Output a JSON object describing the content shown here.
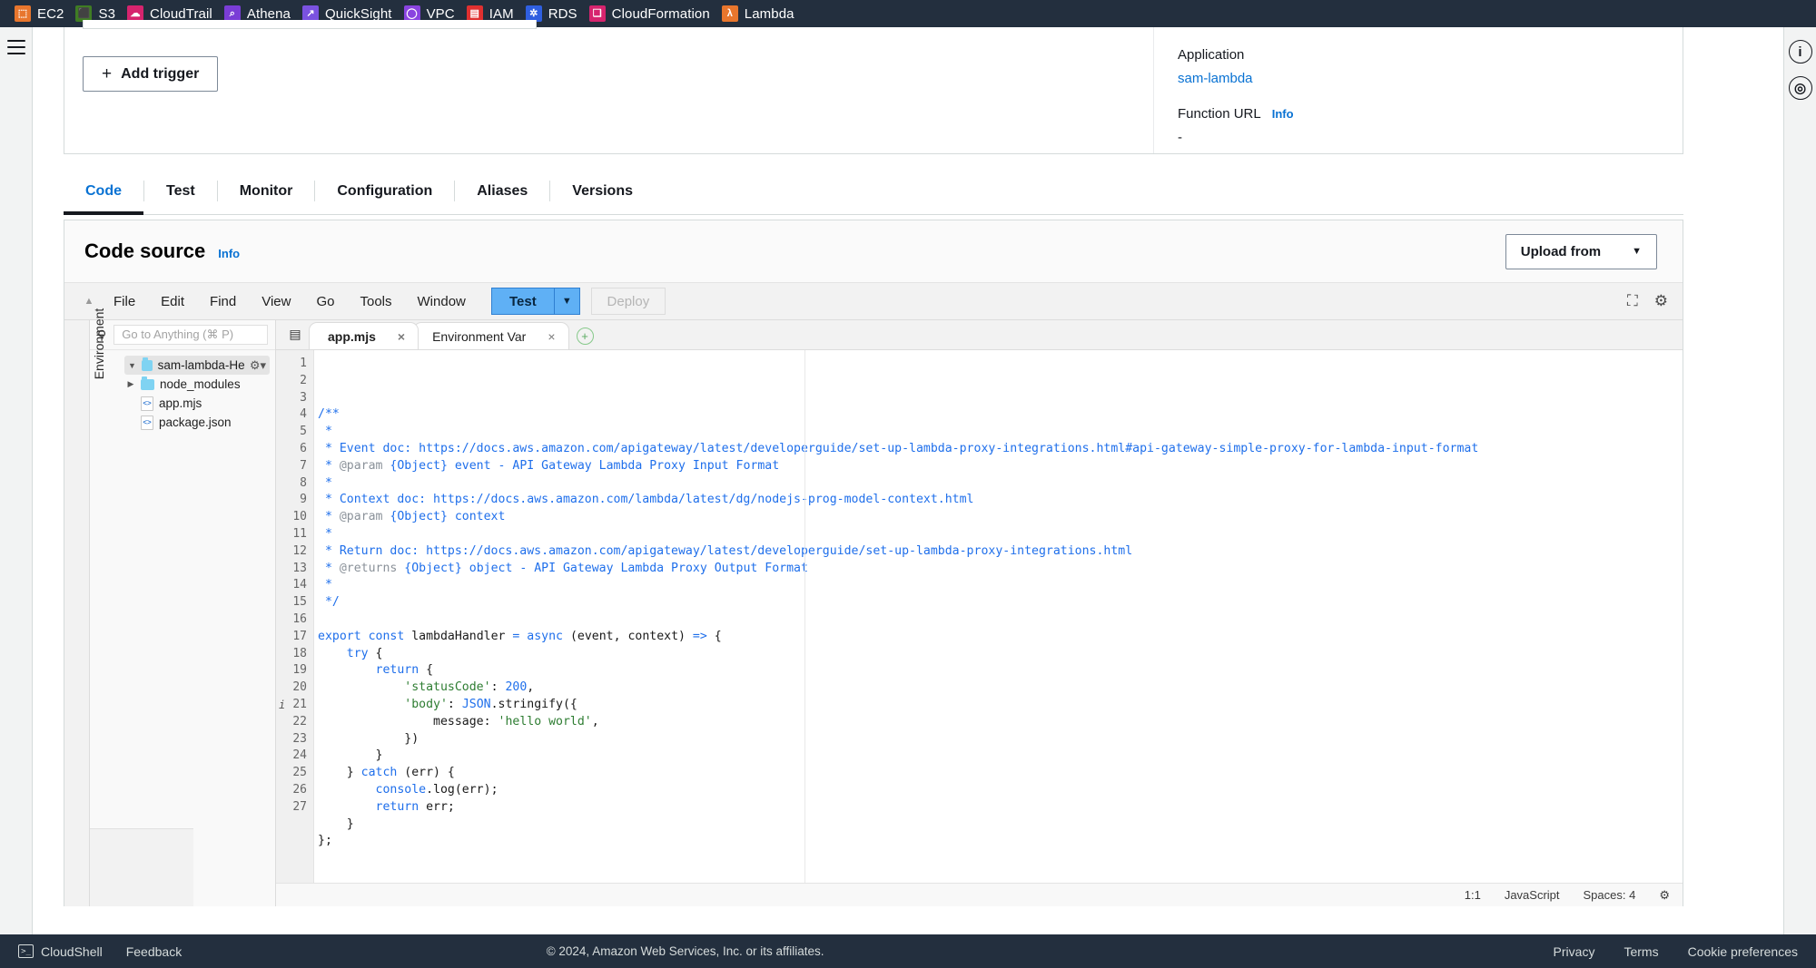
{
  "top_services": [
    {
      "label": "EC2",
      "icon": "ec2-icon",
      "color": "#e8762d",
      "glyph": "⬚"
    },
    {
      "label": "S3",
      "icon": "s3-icon",
      "color": "#3f7d23",
      "glyph": "⬛"
    },
    {
      "label": "CloudTrail",
      "icon": "cloudtrail-icon",
      "color": "#d6246e",
      "glyph": "☁"
    },
    {
      "label": "Athena",
      "icon": "athena-icon",
      "color": "#7a3dd6",
      "glyph": "⌕"
    },
    {
      "label": "QuickSight",
      "icon": "quicksight-icon",
      "color": "#7a52e0",
      "glyph": "↗"
    },
    {
      "label": "VPC",
      "icon": "vpc-icon",
      "color": "#8a44e0",
      "glyph": "◯"
    },
    {
      "label": "IAM",
      "icon": "iam-icon",
      "color": "#e03030",
      "glyph": "▤"
    },
    {
      "label": "RDS",
      "icon": "rds-icon",
      "color": "#2f5fe0",
      "glyph": "✲"
    },
    {
      "label": "CloudFormation",
      "icon": "cloudformation-icon",
      "color": "#d6246e",
      "glyph": "❑"
    },
    {
      "label": "Lambda",
      "icon": "lambda-icon",
      "color": "#e8762d",
      "glyph": "λ"
    }
  ],
  "overview": {
    "add_trigger_label": "Add trigger",
    "application_label": "Application",
    "application_value": "sam-lambda",
    "function_url_label": "Function URL",
    "function_url_info": "Info",
    "function_url_value": "-"
  },
  "tabs": [
    {
      "label": "Code",
      "active": true
    },
    {
      "label": "Test",
      "active": false
    },
    {
      "label": "Monitor",
      "active": false
    },
    {
      "label": "Configuration",
      "active": false
    },
    {
      "label": "Aliases",
      "active": false
    },
    {
      "label": "Versions",
      "active": false
    }
  ],
  "code_source": {
    "title": "Code source",
    "info": "Info",
    "upload_from": "Upload from",
    "caret": "▼"
  },
  "ide": {
    "menus": [
      "File",
      "Edit",
      "Find",
      "View",
      "Go",
      "Tools",
      "Window"
    ],
    "test_button": "Test",
    "test_caret": "▼",
    "deploy_button": "Deploy",
    "expand_icon": "⛶",
    "settings_icon": "⚙",
    "collapse_icon": "▲",
    "environment_label": "Environment",
    "search_placeholder": "Go to Anything (⌘ P)",
    "search_icon": "⚲",
    "file_tree": [
      {
        "label": "sam-lambda-HelloW",
        "type": "folder",
        "expanded": true,
        "depth": 0,
        "selected": true,
        "twisty": "▼",
        "gear": "⚙▾"
      },
      {
        "label": "node_modules",
        "type": "folder",
        "expanded": false,
        "depth": 1,
        "selected": false,
        "twisty": "▶",
        "gear": ""
      },
      {
        "label": "app.mjs",
        "type": "file",
        "expanded": false,
        "depth": 1,
        "selected": false,
        "twisty": "",
        "gear": ""
      },
      {
        "label": "package.json",
        "type": "file",
        "expanded": false,
        "depth": 1,
        "selected": false,
        "twisty": "",
        "gear": ""
      }
    ],
    "editor_tabs": [
      {
        "label": "app.mjs",
        "active": true,
        "close": "×"
      },
      {
        "label": "Environment Var",
        "active": false,
        "close": "×"
      }
    ],
    "add_tab_icon": "+",
    "tab_list_icon": "▤",
    "status": {
      "position": "1:1",
      "language": "JavaScript",
      "spaces": "Spaces: 4",
      "gear": "⚙"
    },
    "warning_line": 21,
    "warning_glyph": "i",
    "total_lines": 27
  },
  "code_lines": [
    {
      "n": 1,
      "segments": [
        {
          "t": "/**",
          "c": "cmt"
        }
      ]
    },
    {
      "n": 2,
      "segments": [
        {
          "t": " *",
          "c": "cmt"
        }
      ]
    },
    {
      "n": 3,
      "segments": [
        {
          "t": " * Event doc: https://docs.aws.amazon.com/apigateway/latest/developerguide/set-up-lambda-proxy-integrations.html#api-gateway-simple-proxy-for-lambda-input-format",
          "c": "cmt"
        }
      ]
    },
    {
      "n": 4,
      "segments": [
        {
          "t": " * ",
          "c": "cmt"
        },
        {
          "t": "@param",
          "c": "tag"
        },
        {
          "t": " {Object} event - API Gateway Lambda Proxy Input Format",
          "c": "cmt"
        }
      ]
    },
    {
      "n": 5,
      "segments": [
        {
          "t": " *",
          "c": "cmt"
        }
      ]
    },
    {
      "n": 6,
      "segments": [
        {
          "t": " * Context doc: https://docs.aws.amazon.com/lambda/latest/dg/nodejs-prog-model-context.html",
          "c": "cmt"
        }
      ]
    },
    {
      "n": 7,
      "segments": [
        {
          "t": " * ",
          "c": "cmt"
        },
        {
          "t": "@param",
          "c": "tag"
        },
        {
          "t": " {Object} context",
          "c": "cmt"
        }
      ]
    },
    {
      "n": 8,
      "segments": [
        {
          "t": " *",
          "c": "cmt"
        }
      ]
    },
    {
      "n": 9,
      "segments": [
        {
          "t": " * Return doc: https://docs.aws.amazon.com/apigateway/latest/developerguide/set-up-lambda-proxy-integrations.html",
          "c": "cmt"
        }
      ]
    },
    {
      "n": 10,
      "segments": [
        {
          "t": " * ",
          "c": "cmt"
        },
        {
          "t": "@returns",
          "c": "tag"
        },
        {
          "t": " {Object} object - API Gateway Lambda Proxy Output Format",
          "c": "cmt"
        }
      ]
    },
    {
      "n": 11,
      "segments": [
        {
          "t": " *",
          "c": "cmt"
        }
      ]
    },
    {
      "n": 12,
      "segments": [
        {
          "t": " */",
          "c": "cmt"
        }
      ]
    },
    {
      "n": 13,
      "segments": [
        {
          "t": "",
          "c": "fn"
        }
      ]
    },
    {
      "n": 14,
      "segments": [
        {
          "t": "export",
          "c": "kw"
        },
        {
          "t": " ",
          "c": "fn"
        },
        {
          "t": "const",
          "c": "kw"
        },
        {
          "t": " lambdaHandler ",
          "c": "fn"
        },
        {
          "t": "=",
          "c": "kw"
        },
        {
          "t": " ",
          "c": "fn"
        },
        {
          "t": "async",
          "c": "kw"
        },
        {
          "t": " (event, context) ",
          "c": "fn"
        },
        {
          "t": "=>",
          "c": "kw"
        },
        {
          "t": " {",
          "c": "fn"
        }
      ]
    },
    {
      "n": 15,
      "segments": [
        {
          "t": "    ",
          "c": "fn"
        },
        {
          "t": "try",
          "c": "kw"
        },
        {
          "t": " {",
          "c": "fn"
        }
      ]
    },
    {
      "n": 16,
      "segments": [
        {
          "t": "        ",
          "c": "fn"
        },
        {
          "t": "return",
          "c": "kw"
        },
        {
          "t": " {",
          "c": "fn"
        }
      ]
    },
    {
      "n": 17,
      "segments": [
        {
          "t": "            ",
          "c": "fn"
        },
        {
          "t": "'statusCode'",
          "c": "str"
        },
        {
          "t": ": ",
          "c": "fn"
        },
        {
          "t": "200",
          "c": "num"
        },
        {
          "t": ",",
          "c": "fn"
        }
      ]
    },
    {
      "n": 18,
      "segments": [
        {
          "t": "            ",
          "c": "fn"
        },
        {
          "t": "'body'",
          "c": "str"
        },
        {
          "t": ": ",
          "c": "fn"
        },
        {
          "t": "JSON",
          "c": "cls"
        },
        {
          "t": ".stringify({",
          "c": "fn"
        }
      ]
    },
    {
      "n": 19,
      "segments": [
        {
          "t": "                message: ",
          "c": "fn"
        },
        {
          "t": "'hello world'",
          "c": "str"
        },
        {
          "t": ",",
          "c": "fn"
        }
      ]
    },
    {
      "n": 20,
      "segments": [
        {
          "t": "            })",
          "c": "fn"
        }
      ]
    },
    {
      "n": 21,
      "segments": [
        {
          "t": "        }",
          "c": "fn"
        }
      ]
    },
    {
      "n": 22,
      "segments": [
        {
          "t": "    } ",
          "c": "fn"
        },
        {
          "t": "catch",
          "c": "kw"
        },
        {
          "t": " (err) {",
          "c": "fn"
        }
      ]
    },
    {
      "n": 23,
      "segments": [
        {
          "t": "        ",
          "c": "fn"
        },
        {
          "t": "console",
          "c": "cls"
        },
        {
          "t": ".log(err);",
          "c": "fn"
        }
      ]
    },
    {
      "n": 24,
      "segments": [
        {
          "t": "        ",
          "c": "fn"
        },
        {
          "t": "return",
          "c": "kw"
        },
        {
          "t": " err;",
          "c": "fn"
        }
      ]
    },
    {
      "n": 25,
      "segments": [
        {
          "t": "    }",
          "c": "fn"
        }
      ]
    },
    {
      "n": 26,
      "segments": [
        {
          "t": "};",
          "c": "fn"
        }
      ]
    },
    {
      "n": 27,
      "segments": [
        {
          "t": "",
          "c": "fn"
        }
      ]
    }
  ],
  "footer": {
    "cloudshell": "CloudShell",
    "feedback": "Feedback",
    "copyright": "© 2024, Amazon Web Services, Inc. or its affiliates.",
    "privacy": "Privacy",
    "terms": "Terms",
    "cookie_preferences": "Cookie preferences"
  },
  "rails": {
    "info_icon": "i",
    "shortcut_icon": "◎",
    "menu_icon": "hamburger"
  }
}
